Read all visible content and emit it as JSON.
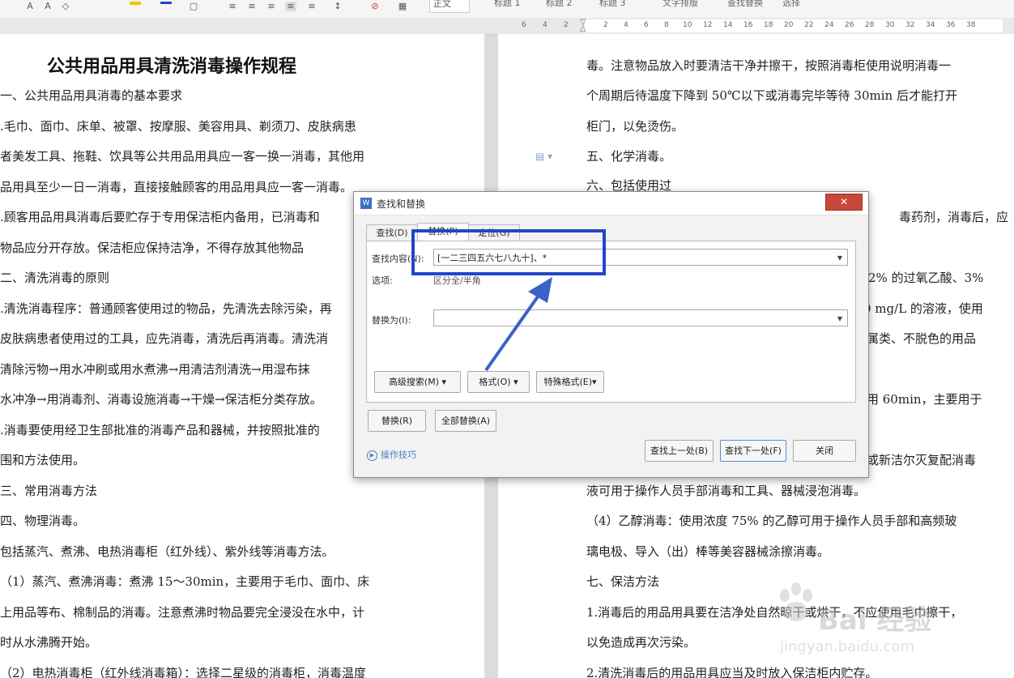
{
  "toolbar": {
    "styles": [
      "正文",
      "标题 1",
      "标题 2",
      "标题 3"
    ],
    "text_layout": "文字排版",
    "find_replace": "查找替换",
    "select": "选择"
  },
  "ruler_numbers": [
    "6",
    "4",
    "2",
    "2",
    "4",
    "6",
    "8",
    "10",
    "12",
    "14",
    "16",
    "18",
    "20",
    "22",
    "24",
    "26",
    "28",
    "30",
    "32",
    "34",
    "36",
    "38"
  ],
  "document": {
    "title": "公共用品用具清洗消毒操作规程",
    "left_lines": [
      "一、公共用品用具消毒的基本要求",
      ".毛巾、面巾、床单、被罩、按摩服、美容用具、剃须刀、皮肤病患",
      "者美发工具、拖鞋、饮具等公共用品用具应一客一换一消毒，其他用",
      "品用具至少一日一消毒，直接接触顾客的用品用具应一客一消毒。",
      ".顾客用品用具消毒后要贮存于专用保洁柜内备用，已消毒和",
      "物品应分开存放。保洁柜应保持洁净，不得存放其他物品",
      "二、清洗消毒的原则",
      ".清洗消毒程序：普通顾客使用过的物品，先清洗去除污染，再",
      "皮肤病患者使用过的工具，应先消毒，清洗后再消毒。清洗消",
      "清除污物→用水冲刷或用水煮沸→用清洁剂清洗→用湿布抹",
      "水冲净→用消毒剂、消毒设施消毒→干燥→保洁柜分类存放。",
      ".消毒要使用经卫生部批准的消毒产品和器械，并按照批准的",
      "围和方法使用。",
      "三、常用消毒方法",
      "四、物理消毒。",
      "包括蒸汽、煮沸、电热消毒柜（红外线）、紫外线等消毒方法。",
      "（1）蒸汽、煮沸消毒：煮沸 15～30min，主要用于毛巾、面巾、床",
      "上用品等布、棉制品的消毒。注意煮沸时物品要完全浸没在水中，计",
      "时从水沸腾开始。",
      "（2）电热消毒柜（红外线消毒箱）：选择二星级的消毒柜，消毒温度"
    ],
    "right_lines": [
      "毒。注意物品放入时要清洁干净并擦干，按照消毒柜使用说明消毒一",
      "个周期后待温度下降到 50℃以下或消毒完毕等待 30min 后才能打开",
      "柜门，以免烫伤。",
      "五、化学消毒。",
      "六、包括使用过",
      "毒药剂，消毒后，应",
      "",
      "2% 的过氧乙酸、3%",
      "0 mg/L 的溶液，使用",
      "属类、不脱色的用品",
      "",
      "用 60min，主要用于",
      "",
      "或新洁尔灭复配消毒",
      "液可用于操作人员手部消毒和工具、器械浸泡消毒。",
      "（4）乙醇消毒：使用浓度 75% 的乙醇可用于操作人员手部和高频玻",
      "璃电极、导入（出）棒等美容器械涂擦消毒。",
      "七、保洁方法",
      "1.消毒后的用品用具要在洁净处自然晾干或烘干，不应使用毛巾擦干，",
      "以免造成再次污染。",
      "2.清洗消毒后的用品用具应当及时放入保洁柜内贮存。"
    ]
  },
  "dialog": {
    "title": "查找和替换",
    "close_label": "✕",
    "tabs": [
      "查找(D)",
      "替换(P)",
      "定位(G)"
    ],
    "find_label": "查找内容(N):",
    "find_value": "[一二三四五六七八九十]、*",
    "options_label": "选项:",
    "options_value": "区分全/半角",
    "replace_label": "替换为(I):",
    "replace_value": "",
    "advanced_search": "高级搜索(M)",
    "format": "格式(O)",
    "special_format": "特殊格式(E)",
    "replace_btn": "替换(R)",
    "replace_all_btn": "全部替换(A)",
    "help_link": "操作技巧",
    "find_prev": "查找上一处(B)",
    "find_next": "查找下一处(F)",
    "close_btn": "关闭"
  },
  "watermark": {
    "brand": "Bai 经验",
    "url": "jingyan.baidu.com"
  },
  "colors": {
    "highlight": "#2046c8",
    "arrow": "#3a62c8",
    "close_button": "#c9483a"
  }
}
